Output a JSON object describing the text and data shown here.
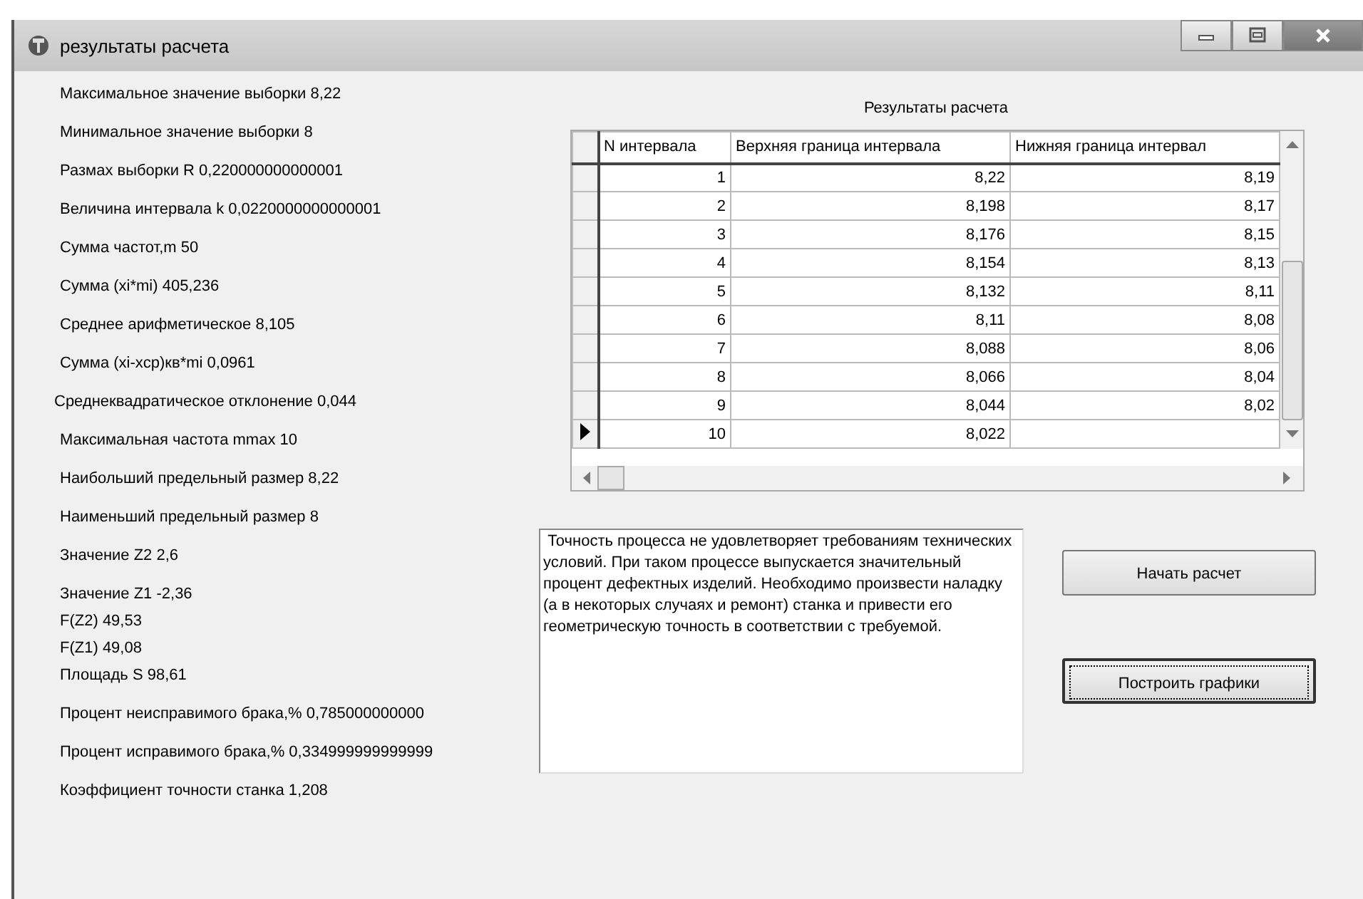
{
  "window": {
    "title": "результаты расчета"
  },
  "results": [
    {
      "text": "Максимальное значение выборки  8,22"
    },
    {
      "text": "Минимальное значение выборки  8"
    },
    {
      "text": "Размах выборки R  0,220000000000001"
    },
    {
      "text": "Величина интервала k  0,0220000000000001"
    },
    {
      "text": "Сумма частот,m  50"
    },
    {
      "text": "Сумма (xi*mi)  405,236"
    },
    {
      "text": "Среднее арифметическое  8,105"
    },
    {
      "text": "Сумма (xi-xcp)кв*mi  0,0961"
    },
    {
      "text": "Среднеквадратическое отклонение   0,044"
    },
    {
      "text": "Максимальная частота mmax  10"
    },
    {
      "text": "Наибольший предельный размер  8,22"
    },
    {
      "text": "Наименьший предельный размер   8"
    },
    {
      "text": "Значение Z2  2,6"
    },
    {
      "text": "Значение Z1  -2,36"
    },
    {
      "text": "F(Z2)  49,53"
    },
    {
      "text": "F(Z1)  49,08"
    },
    {
      "text": "Площадь S  98,61"
    },
    {
      "text": "Процент неисправимого брака,%  0,785000000000"
    },
    {
      "text": "Процент исправимого брака,%   0,334999999999999"
    },
    {
      "text": "Коэффициент точности станка   1,208"
    }
  ],
  "table": {
    "title": "Результаты расчета",
    "columns": [
      "N интервала",
      "Верхняя граница интервала",
      "Нижняя граница интервал"
    ],
    "rows": [
      {
        "selected": false,
        "cells": [
          "1",
          "8,22",
          "8,19"
        ]
      },
      {
        "selected": false,
        "cells": [
          "2",
          "8,198",
          "8,17"
        ]
      },
      {
        "selected": false,
        "cells": [
          "3",
          "8,176",
          "8,15"
        ]
      },
      {
        "selected": false,
        "cells": [
          "4",
          "8,154",
          "8,13"
        ]
      },
      {
        "selected": false,
        "cells": [
          "5",
          "8,132",
          "8,11"
        ]
      },
      {
        "selected": false,
        "cells": [
          "6",
          "8,11",
          "8,08"
        ]
      },
      {
        "selected": false,
        "cells": [
          "7",
          "8,088",
          "8,06"
        ]
      },
      {
        "selected": false,
        "cells": [
          "8",
          "8,066",
          "8,04"
        ]
      },
      {
        "selected": false,
        "cells": [
          "9",
          "8,044",
          "8,02"
        ]
      },
      {
        "selected": true,
        "cells": [
          "10",
          "8,022"
        ]
      }
    ]
  },
  "message": " Точность процесса не удовлетворяет требованиям технических условий. При таком процессе выпускается значительный процент дефектных изделий. Необходимо произвести наладку (а в некоторых случаях и ремонт) станка и привести его геометрическую точность в соответствии с требуемой.",
  "buttons": [
    {
      "label": "Начать расчет",
      "focused": false
    },
    {
      "label": "Построить графики",
      "focused": true
    }
  ]
}
